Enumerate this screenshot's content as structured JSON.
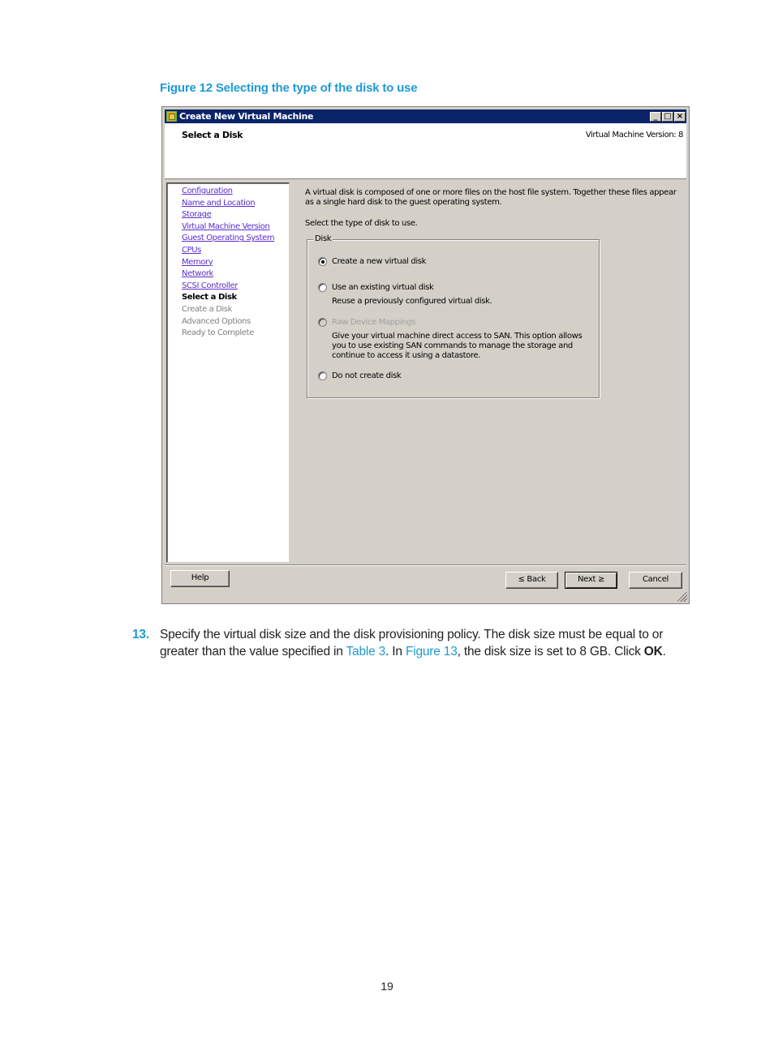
{
  "document": {
    "figure_caption": "Figure 12 Selecting the type of the disk to use",
    "page_number": "19",
    "step": {
      "number": "13.",
      "text_1": "Specify the virtual disk size and the disk provisioning policy. The disk size must be equal to or greater than the value specified in ",
      "link_1": "Table 3",
      "text_2": ". In ",
      "link_2": "Figure 13",
      "text_3": ", the disk size is set to 8 GB. Click ",
      "bold": "OK",
      "text_4": "."
    },
    "link_color": "#1f9ad6"
  },
  "window": {
    "title": "Create New Virtual Machine",
    "controls": {
      "minimize": "_",
      "maximize": "□",
      "close": "×"
    },
    "header": {
      "title": "Select a Disk",
      "version": "Virtual Machine Version: 8"
    },
    "nav": {
      "items": [
        {
          "label": "Configuration",
          "state": "link"
        },
        {
          "label": "Name and Location",
          "state": "link"
        },
        {
          "label": "Storage",
          "state": "link"
        },
        {
          "label": "Virtual Machine Version",
          "state": "link"
        },
        {
          "label": "Guest Operating System",
          "state": "link"
        },
        {
          "label": "CPUs",
          "state": "link"
        },
        {
          "label": "Memory",
          "state": "link"
        },
        {
          "label": "Network",
          "state": "link"
        },
        {
          "label": "SCSI Controller",
          "state": "link"
        },
        {
          "label": "Select a Disk",
          "state": "current"
        },
        {
          "label": "Create a Disk",
          "state": "pending"
        },
        {
          "label": "Advanced Options",
          "state": "pending"
        },
        {
          "label": "Ready to Complete",
          "state": "pending"
        }
      ]
    },
    "content": {
      "intro": "A virtual disk is composed of one or more files on the host file system. Together these files appear as a single hard disk to the guest operating system.",
      "select_label": "Select the type of disk to use.",
      "group_label": "Disk",
      "options": [
        {
          "label": "Create a new virtual disk",
          "checked": true,
          "disabled": false,
          "description": ""
        },
        {
          "label": "Use an existing virtual disk",
          "checked": false,
          "disabled": false,
          "description": "Reuse a previously configured virtual disk."
        },
        {
          "label": "Raw Device Mappings",
          "checked": false,
          "disabled": true,
          "description": "Give your virtual machine direct access to SAN. This option allows you to use existing SAN commands to manage the storage and continue to access it using a datastore."
        },
        {
          "label": "Do not create disk",
          "checked": false,
          "disabled": false,
          "description": ""
        }
      ]
    },
    "buttons": {
      "help": "Help",
      "back": "≤ Back",
      "next": "Next ≥",
      "cancel": "Cancel"
    }
  }
}
